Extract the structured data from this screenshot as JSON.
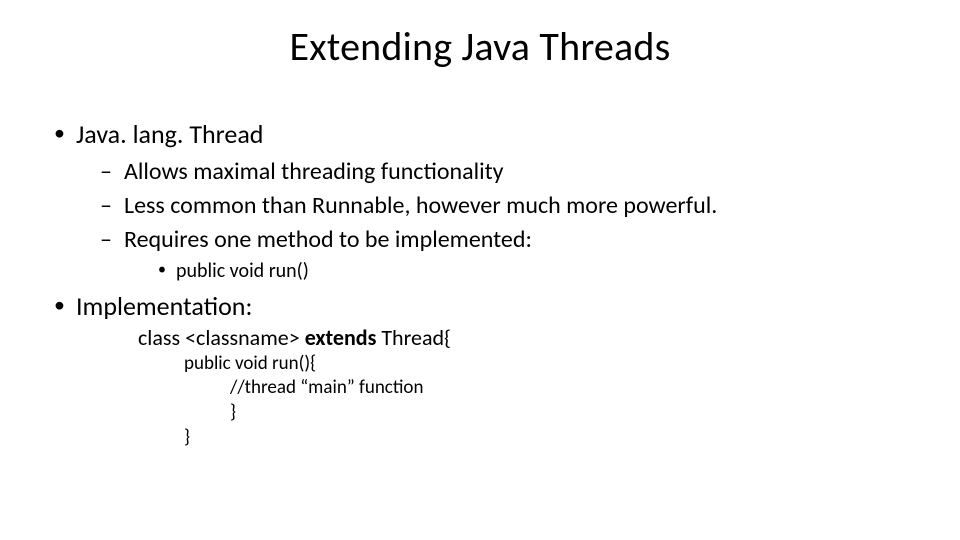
{
  "title": "Extending Java Threads",
  "bullets": {
    "b1": "Java. lang. Thread",
    "b1_subs": {
      "s1": "Allows maximal threading functionality",
      "s2": "Less common than Runnable, however much more powerful.",
      "s3": "Requires one method to be implemented:",
      "s3_sub": "public void run()"
    },
    "b2": "Implementation:",
    "code": {
      "line1_a": "class <classname> ",
      "line1_b_bold": "extends",
      "line1_c": " Thread{",
      "line2": "public void run(){",
      "line3": "//thread “main” function",
      "line4": "}",
      "line5": "}"
    }
  }
}
